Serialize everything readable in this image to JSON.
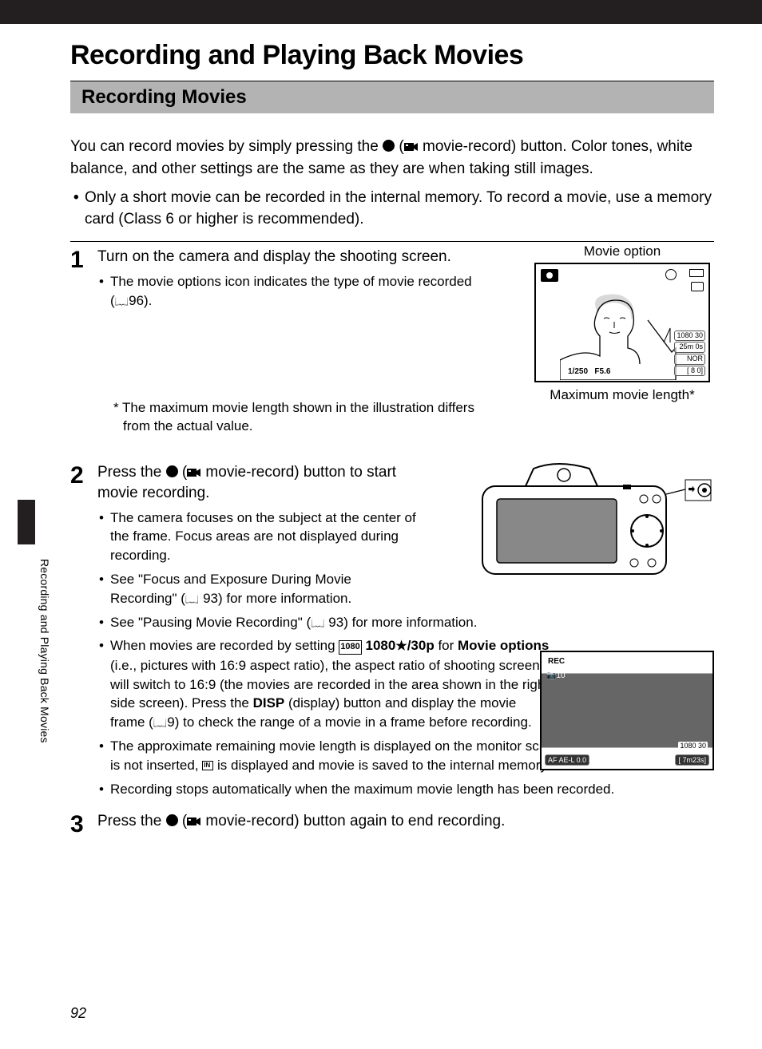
{
  "page_number": "92",
  "side_tab_text": "Recording and Playing Back Movies",
  "title": "Recording and Playing Back Movies",
  "section": "Recording Movies",
  "intro_before": "You can record movies by simply pressing the ",
  "intro_mid": " (",
  "intro_after": " movie-record) button. Color tones, white balance, and other settings are the same as they are when taking still images.",
  "top_bullet": "Only a short movie can be recorded in the internal memory. To record a movie, use a memory card (Class 6 or higher is recommended).",
  "step1": {
    "num": "1",
    "heading": "Turn on the camera and display the shooting screen.",
    "bullet1_a": "The movie options icon indicates the type of movie recorded (",
    "bullet1_ref": "96).",
    "footnote": "*  The maximum movie length shown in the illustration differs from the actual value.",
    "label_option": "Movie option",
    "label_maxlen": "Maximum movie length*",
    "lcd": {
      "res": "1080 30",
      "time": "25m 0s",
      "mode": "NOR",
      "count": "[   8 0]",
      "shutter": "1/250",
      "aperture": "F5.6"
    }
  },
  "step2": {
    "num": "2",
    "heading_a": "Press the ",
    "heading_mid": " (",
    "heading_b": " movie-record) button to start movie recording.",
    "b1": "The camera focuses on the subject at the center of the frame. Focus areas are not displayed during recording.",
    "b2_a": "See \"Focus and Exposure During Movie Recording\" (",
    "b2_ref": " 93) for more information.",
    "b3_a": "See \"Pausing Movie Recording\" (",
    "b3_ref": " 93) for more information.",
    "b4_a": "When movies are recorded by setting ",
    "b4_res": "1080",
    "b4_bold": " 1080",
    "b4_bold2": "/30p",
    "b4_for": " for ",
    "b4_mo": "Movie options",
    "b4_rest1": " (i.e., pictures with 16:9 aspect ratio), the aspect ratio of shooting screen will switch to 16:9 (the movies are recorded in the area shown in the right side screen). Press the ",
    "b4_disp": "DISP",
    "b4_rest2": " (display) button and display the movie frame (",
    "b4_ref": "9) to check the range of a movie in a frame before recording.",
    "b5_a": "The approximate remaining movie length is displayed on the monitor screen. When a memory card is not inserted, ",
    "b5_b": " is displayed and movie is saved to the internal memory.",
    "b6": "Recording stops automatically when the maximum movie length has been recorded.",
    "lcd": {
      "rec": "REC",
      "in": "10",
      "res": "1080 30",
      "af": "AF    AE-L  0.0",
      "time": "[  7m23s]"
    }
  },
  "step3": {
    "num": "3",
    "heading_a": "Press the ",
    "heading_mid": " (",
    "heading_b": " movie-record) button again to end recording."
  }
}
